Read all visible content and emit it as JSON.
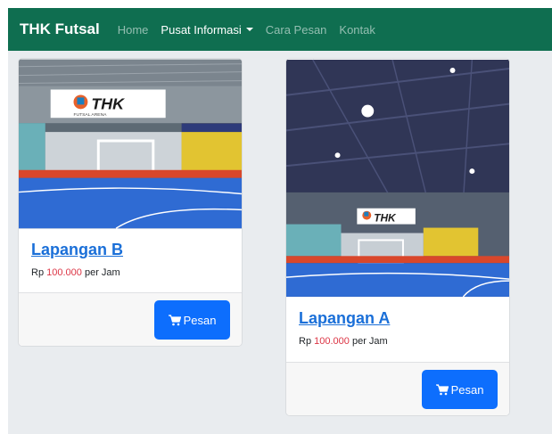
{
  "navbar": {
    "brand": "THK Futsal",
    "links": [
      {
        "label": "Home"
      },
      {
        "label": "Pusat Informasi"
      },
      {
        "label": "Cara Pesan"
      },
      {
        "label": "Kontak"
      }
    ]
  },
  "cards": [
    {
      "title": "Lapangan B",
      "price_prefix": "Rp",
      "price_amount": "100.000",
      "price_suffix": "per Jam",
      "button_label": "Pesan",
      "image_banner": "THK",
      "image_sub": "FUTSAL ARENA"
    },
    {
      "title": "Lapangan A",
      "price_prefix": "Rp",
      "price_amount": "100.000",
      "price_suffix": "per Jam",
      "button_label": "Pesan",
      "image_banner": "THK",
      "image_sub": "FUTSAL ARENA"
    }
  ],
  "colors": {
    "navbar": "#0f6e50",
    "button": "#0d6efd",
    "price": "#dc3545",
    "link": "#1a6fd8"
  },
  "icons": [
    "shopping-cart-icon",
    "caret-down-icon"
  ]
}
